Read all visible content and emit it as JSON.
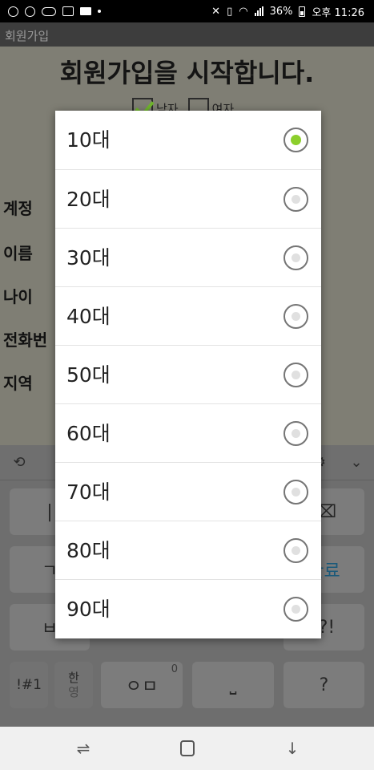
{
  "status_bar": {
    "battery": "36%",
    "time": "오후 11:26"
  },
  "app_bar": {
    "title": "회원가입"
  },
  "form": {
    "title": "회원가입을 시작합니다.",
    "gender_male": "남자",
    "gender_female": "여자",
    "labels": [
      "계정",
      "이름",
      "나이",
      "전화번",
      "지역"
    ]
  },
  "keyboard": {
    "keys": {
      "backspace": "⌫",
      "done": "완료",
      "punct": ".?!",
      "symbols": "!#1",
      "lang_top": "한",
      "lang_bottom": "영",
      "ieung_mieum": "ㅇㅁ",
      "zero": "0",
      "space": "⎵",
      "question": "?",
      "giyeok": "ㄱ",
      "bieup": "ㅂ",
      "pipe": "|"
    }
  },
  "dialog": {
    "selected_index": 0,
    "options": [
      "10대",
      "20대",
      "30대",
      "40대",
      "50대",
      "60대",
      "70대",
      "80대",
      "90대"
    ]
  },
  "colors": {
    "accent_green": "#8ccf2c",
    "dialog_bg": "#ffffff",
    "scrim": "#7f7e74"
  }
}
